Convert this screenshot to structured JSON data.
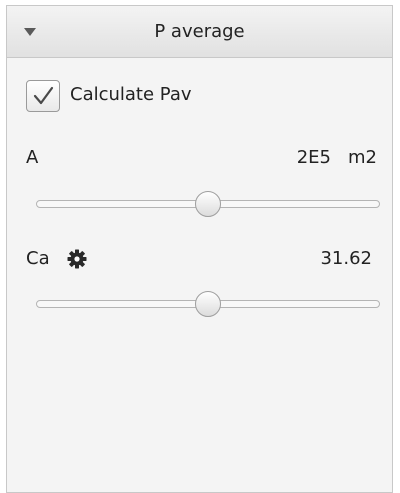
{
  "panel": {
    "title": "P average",
    "collapse_icon": "triangle-down-icon"
  },
  "calculate": {
    "label": "Calculate Pav",
    "checked": true,
    "check_icon": "checkmark-icon"
  },
  "params": [
    {
      "label": "A",
      "value": "2E5",
      "unit": "m2",
      "slider_fraction": 0.5
    },
    {
      "label": "Ca",
      "settings_icon": "gear-icon",
      "value": "31.62",
      "unit": "",
      "slider_fraction": 0.5
    }
  ],
  "colors": {
    "panel_bg": "#f4f4f4",
    "header_bg": "#e6e6e6",
    "border": "#c8c8c8",
    "text": "#222222"
  }
}
